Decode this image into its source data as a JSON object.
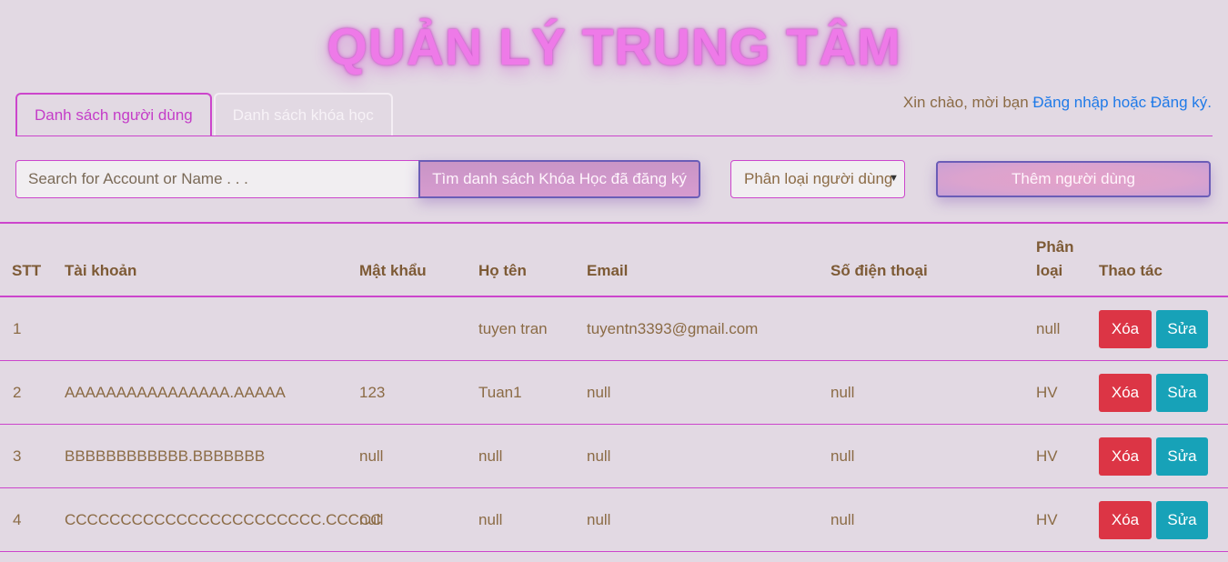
{
  "header": {
    "title": "QUẢN LÝ TRUNG TÂM",
    "greeting_prefix": "Xin chào, mời bạn ",
    "login_link": "Đăng nhập hoặc Đăng ký."
  },
  "tabs": [
    {
      "label": "Danh sách người dùng",
      "active": true
    },
    {
      "label": "Danh sách khóa học",
      "active": false
    }
  ],
  "toolbar": {
    "search_placeholder": "Search for Account or Name . . .",
    "search_button": "Tìm danh sách Khóa Học đã đăng ký",
    "filter_select": "Phân loại người dùng",
    "add_button": "Thêm người dùng"
  },
  "table": {
    "headers": {
      "stt": "STT",
      "account": "Tài khoản",
      "password": "Mật khẩu",
      "name": "Họ tên",
      "email": "Email",
      "phone": "Số điện thoại",
      "type_line1": "Phân",
      "type_line2": "loại",
      "actions": "Thao tác"
    },
    "delete_label": "Xóa",
    "edit_label": "Sửa",
    "rows": [
      {
        "stt": "1",
        "account": "",
        "password": "",
        "name": "tuyen tran",
        "email": "tuyentn3393@gmail.com",
        "phone": "",
        "type": "null"
      },
      {
        "stt": "2",
        "account": "AAAAAAAAAAAAAAAA.AAAAA",
        "password": "123",
        "name": "Tuan1",
        "email": "null",
        "phone": "null",
        "type": "HV"
      },
      {
        "stt": "3",
        "account": "BBBBBBBBBBBB.BBBBBBB",
        "password": "null",
        "name": "null",
        "email": "null",
        "phone": "null",
        "type": "HV"
      },
      {
        "stt": "4",
        "account": "CCCCCCCCCCCCCCCCCCCCCCC.CCCCC",
        "password": "null",
        "name": "null",
        "email": "null",
        "phone": "null",
        "type": "HV"
      }
    ]
  },
  "colors": {
    "background": "#e2d9e3",
    "accent": "#cc45cc",
    "title": "#ee7ae8",
    "text": "#8b6b45",
    "delete": "#dc3545",
    "edit": "#17a2b8",
    "link": "#1f7ae8"
  }
}
